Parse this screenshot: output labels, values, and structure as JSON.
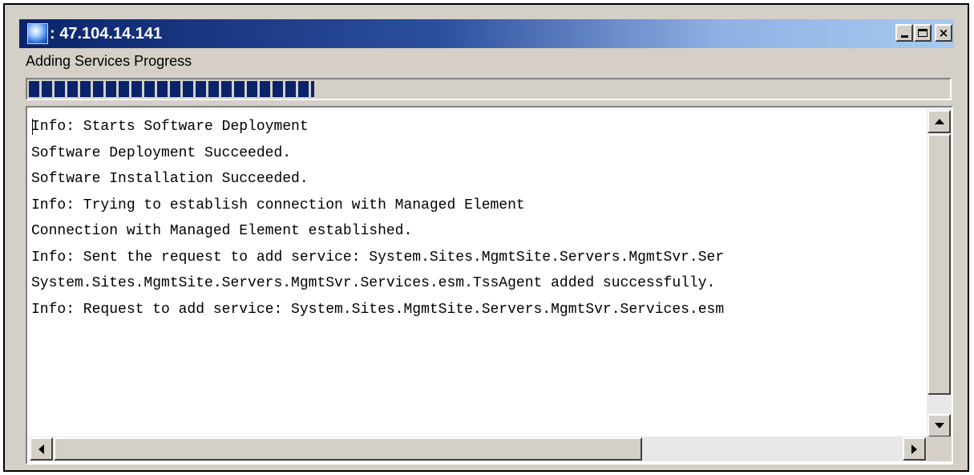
{
  "window": {
    "title": ": 47.104.14.141",
    "icon": "globe-icon",
    "controls": {
      "minimize": "minimize-icon",
      "maximize": "maximize-icon",
      "close": "×"
    }
  },
  "heading": "Adding Services Progress",
  "progress": {
    "percent": 31,
    "color": "#0a246a"
  },
  "log": {
    "lines": [
      "Info: Starts Software Deployment",
      "Software Deployment Succeeded.",
      "Software Installation Succeeded.",
      "Info: Trying to establish connection with Managed Element",
      "Connection with Managed Element established.",
      "Info: Sent the request to add service: System.Sites.MgmtSite.Servers.MgmtSvr.Ser",
      "System.Sites.MgmtSite.Servers.MgmtSvr.Services.esm.TssAgent added successfully.",
      "Info: Request to add service: System.Sites.MgmtSite.Servers.MgmtSvr.Services.esm"
    ]
  },
  "colors": {
    "title_gradient_start": "#0a246a",
    "title_gradient_end": "#a6caf0",
    "chrome": "#d4d0c8"
  }
}
